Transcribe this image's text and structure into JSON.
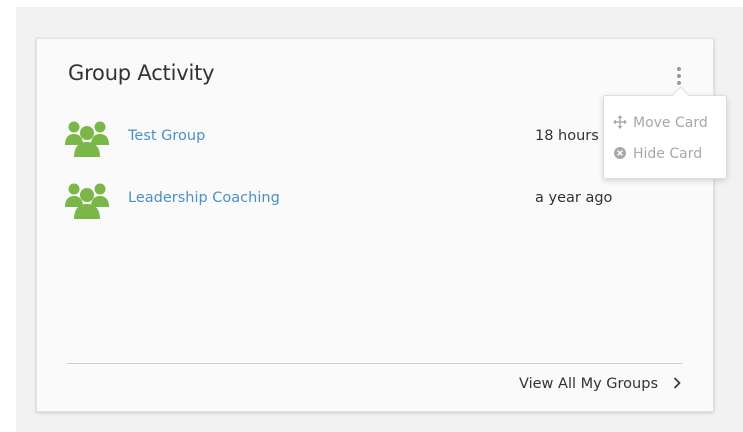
{
  "card": {
    "title": "Group Activity",
    "groups": [
      {
        "name": "Test Group",
        "time": "18 hours ago"
      },
      {
        "name": "Leadership Coaching",
        "time": "a year ago"
      }
    ],
    "footer_link": "View All My Groups"
  },
  "menu": {
    "items": [
      {
        "label": "Move Card",
        "icon": "move-icon"
      },
      {
        "label": "Hide Card",
        "icon": "hide-icon"
      }
    ]
  },
  "colors": {
    "group_icon": "#7ab648",
    "link": "#4a90c9",
    "text": "#333333",
    "menu_text": "#a8a8a8"
  }
}
